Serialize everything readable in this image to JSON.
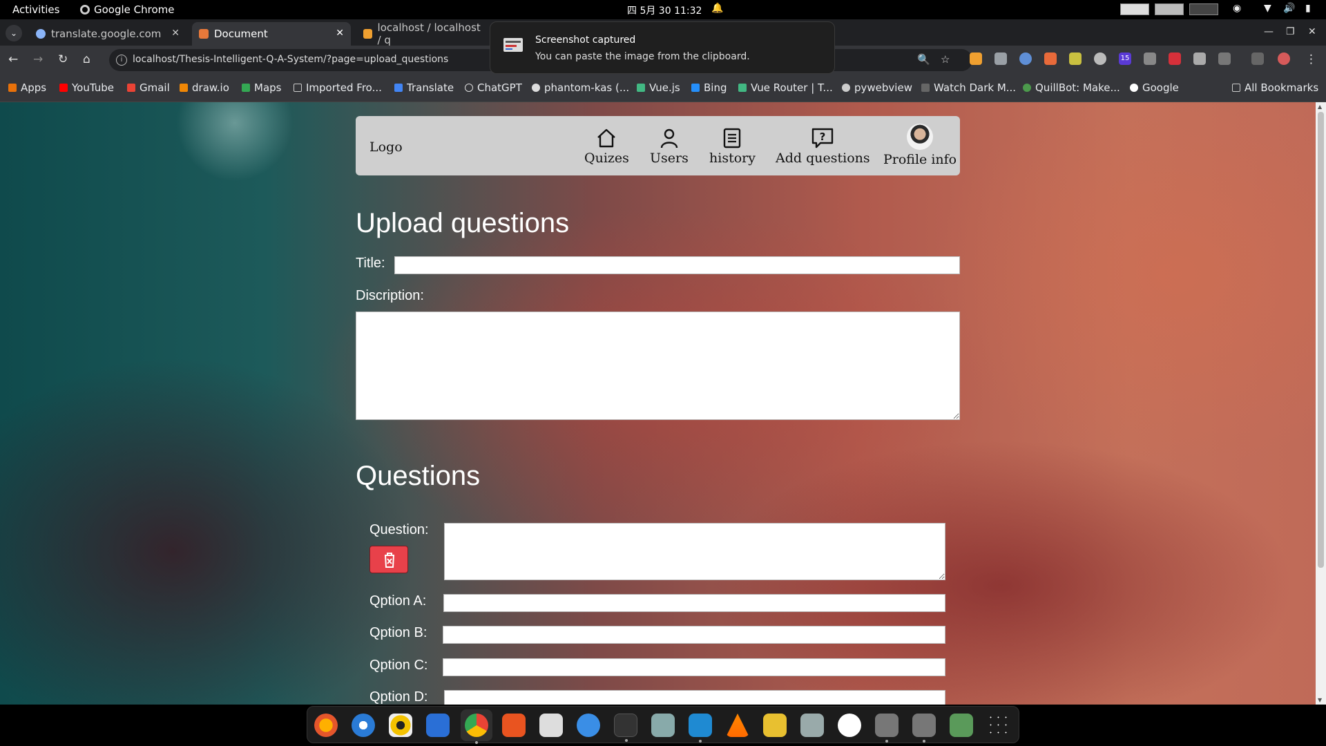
{
  "system_bar": {
    "activities": "Activities",
    "app_name": "Google Chrome",
    "clock": "四 5月 30  11:32"
  },
  "browser": {
    "tabs": [
      {
        "title": "translate.google.com"
      },
      {
        "title": "Document"
      },
      {
        "title": "localhost / localhost / q"
      }
    ],
    "url": "localhost/Thesis-Intelligent-Q-A-System/?page=upload_questions",
    "extension_badge": "15",
    "bookmarks": [
      "Apps",
      "YouTube",
      "Gmail",
      "draw.io",
      "Maps",
      "Imported Fro...",
      "Translate",
      "ChatGPT",
      "phantom-kas (...",
      "Vue.js",
      "Bing",
      "Vue Router | T...",
      "pywebview",
      "Watch Dark M...",
      "QuillBot: Make...",
      "Google"
    ],
    "all_bookmarks": "All Bookmarks"
  },
  "notification": {
    "title": "Screenshot captured",
    "body": "You can paste the image from the clipboard."
  },
  "page": {
    "navbar": {
      "logo": "Logo",
      "items": [
        {
          "label": "Quizes",
          "icon": "home-icon"
        },
        {
          "label": "Users",
          "icon": "user-icon"
        },
        {
          "label": "history",
          "icon": "document-icon"
        },
        {
          "label": "Add questions",
          "icon": "question-bubble-icon"
        },
        {
          "label": "Profile info",
          "icon": "avatar"
        }
      ]
    },
    "upload_heading": "Upload questions",
    "title_label": "Title:",
    "title_value": "",
    "description_label": "Discription:",
    "description_value": "",
    "questions_heading": "Questions",
    "question": {
      "question_label": "Question:",
      "question_value": "",
      "options": [
        {
          "label": "Qption A:",
          "value": ""
        },
        {
          "label": "Qption B:",
          "value": ""
        },
        {
          "label": "Qption C:",
          "value": ""
        },
        {
          "label": "Qption D:",
          "value": ""
        }
      ]
    }
  },
  "colors": {
    "navbar_bg": "#cfcfcf",
    "delete_button": "#e8414a",
    "chrome_dark": "#202124"
  }
}
